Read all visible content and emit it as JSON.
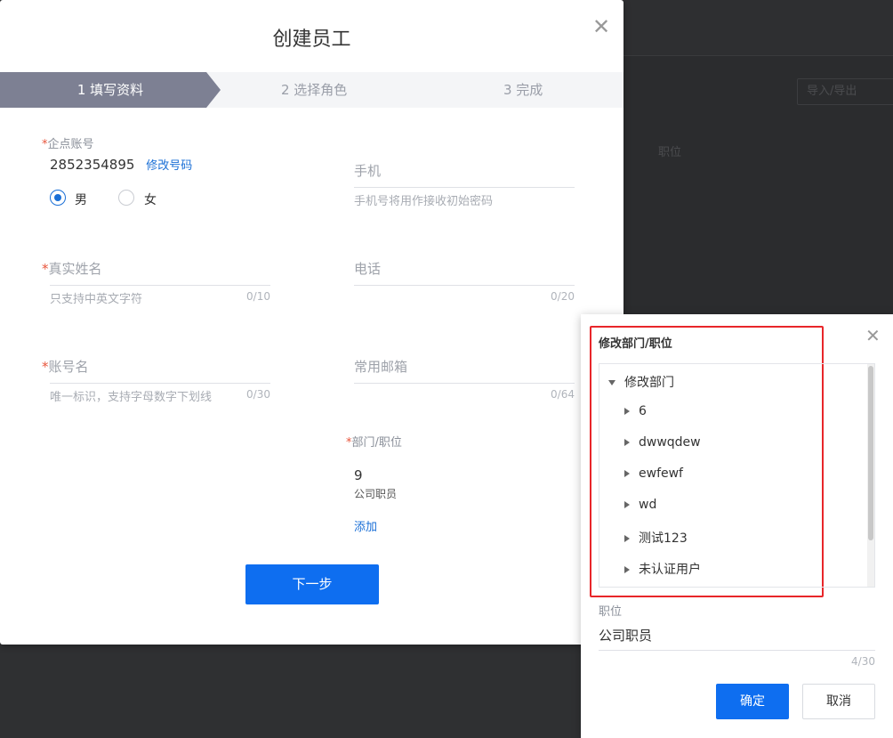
{
  "background": {
    "import_export_label": "导入/导出",
    "column_label": "职位"
  },
  "modal": {
    "title": "创建员工",
    "steps": [
      {
        "label": "1 填写资料",
        "active": true
      },
      {
        "label": "2 选择角色",
        "active": false
      },
      {
        "label": "3 完成",
        "active": false
      }
    ],
    "account": {
      "label": "企点账号",
      "value": "2852354895",
      "modify_link": "修改号码"
    },
    "gender": {
      "options": [
        "男",
        "女"
      ],
      "selected": "男"
    },
    "mobile": {
      "label": "手机",
      "hint": "手机号将用作接收初始密码"
    },
    "real_name": {
      "label": "真实姓名",
      "placeholder": "只支持中英文字符",
      "count": "0/10"
    },
    "phone": {
      "label": "电话",
      "count": "0/20"
    },
    "account_name": {
      "label": "账号名",
      "placeholder": "唯一标识，支持字母数字下划线",
      "count": "0/30"
    },
    "email": {
      "label": "常用邮箱",
      "count": "0/64"
    },
    "dept_position": {
      "label": "部门/职位",
      "dept_value": "9",
      "position_value": "公司职员",
      "add_link": "添加"
    },
    "next_button": "下一步"
  },
  "panel": {
    "title": "修改部门/职位",
    "tree": {
      "root": "修改部门",
      "children": [
        "6",
        "dwwqdew",
        "ewfewf",
        "wd",
        "测试123",
        "未认证用户"
      ]
    },
    "position": {
      "label": "职位",
      "value": "公司职员",
      "count": "4/30"
    },
    "confirm_button": "确定",
    "cancel_button": "取消"
  },
  "colors": {
    "primary": "#0e6ef0",
    "link": "#1a6fd6",
    "required": "#e8553c",
    "highlight_box": "#e8262a",
    "active_step": "#7d8093"
  }
}
